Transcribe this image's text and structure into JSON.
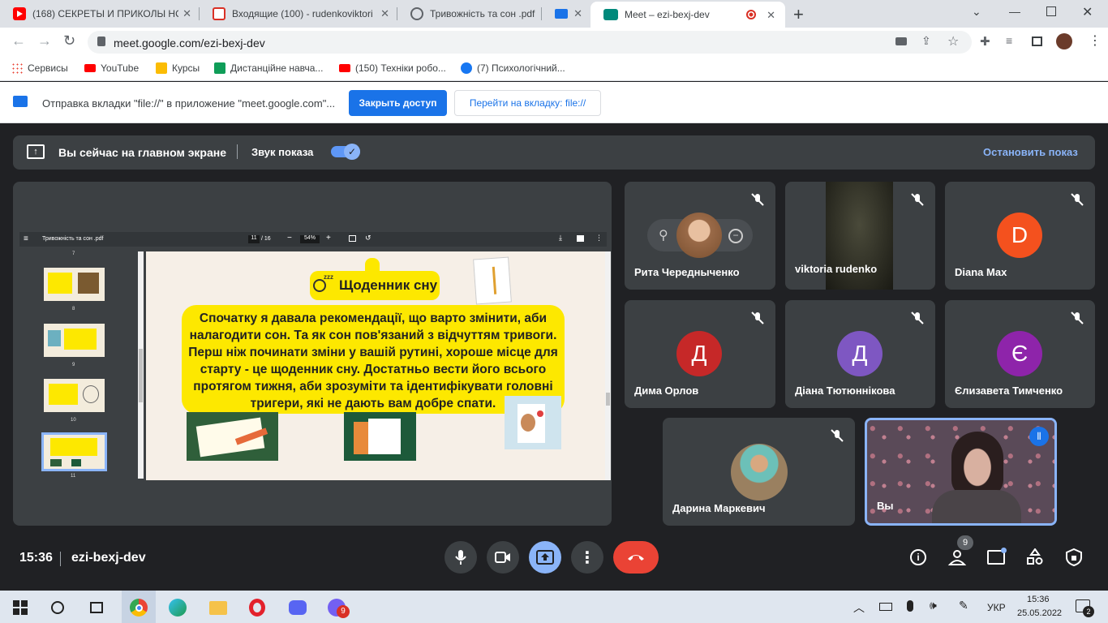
{
  "tabs": [
    {
      "title": "(168) СЕКРЕТЫ И ПРИКОЛЫ НОВ",
      "icon": "youtube-icon",
      "color": "#ff0000"
    },
    {
      "title": "Входящие (100) - rudenkoviktori",
      "icon": "gmail-icon",
      "color": "#d93025"
    },
    {
      "title": "Тривожність та сон .pdf",
      "icon": "globe-icon",
      "color": "#5f6368"
    },
    {
      "title": "",
      "icon": "window-icon",
      "color": "#1a73e8"
    },
    {
      "title": "Meet – ezi-bexj-dev",
      "icon": "meet-icon",
      "color": "#00897b"
    }
  ],
  "url": "meet.google.com/ezi-bexj-dev",
  "bookmarks": [
    {
      "label": "Сервисы",
      "color": "#ea4335"
    },
    {
      "label": "YouTube",
      "color": "#ff0000"
    },
    {
      "label": "Курсы",
      "color": "#fbbc04"
    },
    {
      "label": "Дистанційне навча...",
      "color": "#0f9d58"
    },
    {
      "label": "(150) Техніки робо...",
      "color": "#ff0000"
    },
    {
      "label": "(7) Психологічний...",
      "color": "#1877f2"
    }
  ],
  "infobar": {
    "message": "Отправка вкладки \"file://\" в приложение \"meet.google.com\"...",
    "primary": "Закрыть доступ",
    "secondary": "Перейти на вкладку: file://"
  },
  "presbar": {
    "status": "Вы сейчас на главном экране",
    "sound": "Звук показа",
    "stop": "Остановить показ"
  },
  "pdf": {
    "title": "Тривожність та сон .pdf",
    "page": "11",
    "pages": "/ 16",
    "zoom": "54%",
    "thumbs": [
      "7",
      "8",
      "9",
      "10",
      "11"
    ],
    "slide_title": "Щоденник сну",
    "slide_text": "Спочатку я давала рекомендації, що варто змінити, аби налагодити сон. Та як сон пов'язаний з відчуттям тривоги. Перш ніж починати зміни у вашій рутині, хороше місце для старту - це щоденник сну. Достатньо вести його всього протягом тижня, аби зрозуміти та ідентифікувати головні тригери, які не дають вам добре спати.",
    "slide_sleep": "zzz"
  },
  "participants": [
    {
      "name": "Рита Чередныченко",
      "initial": "",
      "color": "#b08060"
    },
    {
      "name": "viktoria rudenko",
      "initial": "",
      "color": "#2a2b22"
    },
    {
      "name": "Diana Max",
      "initial": "D",
      "color": "#f4511e"
    },
    {
      "name": "Дима Орлов",
      "initial": "Д",
      "color": "#c62828"
    },
    {
      "name": "Діана Тютюннікова",
      "initial": "Д",
      "color": "#7e57c2"
    },
    {
      "name": "Єлизавета Тимченко",
      "initial": "Є",
      "color": "#8e24aa"
    },
    {
      "name": "Дарина Маркевич",
      "initial": "",
      "color": "#a08868"
    },
    {
      "name": "Вы",
      "initial": "",
      "color": "#6b4a5a"
    }
  ],
  "meeting": {
    "time": "15:36",
    "code": "ezi-bexj-dev",
    "people_count": "9"
  },
  "taskbar": {
    "lang": "УКР",
    "time": "15:36",
    "date": "25.05.2022",
    "notif": "2",
    "viber_badge": "9"
  },
  "colors": {
    "accent": "#8ab4f8",
    "end_call": "#ea4335",
    "present": "#8ab4f8",
    "slide_yellow": "#fde800"
  }
}
